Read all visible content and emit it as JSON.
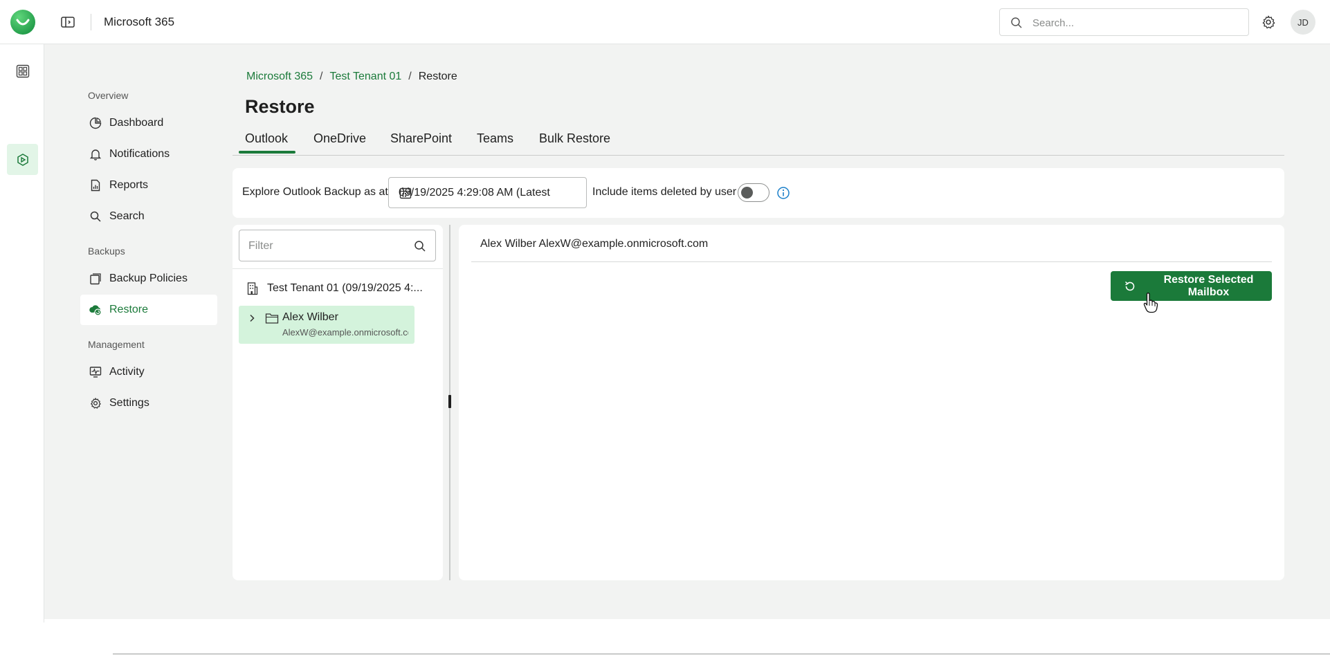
{
  "header": {
    "app_title": "Microsoft 365",
    "search_placeholder": "Search...",
    "avatar_initials": "JD"
  },
  "nav": {
    "sections": [
      {
        "label": "Overview",
        "items": [
          "Dashboard",
          "Notifications",
          "Reports",
          "Search"
        ]
      },
      {
        "label": "Backups",
        "items": [
          "Backup Policies",
          "Restore"
        ]
      },
      {
        "label": "Management",
        "items": [
          "Activity",
          "Settings"
        ]
      }
    ],
    "active_item": "Restore"
  },
  "breadcrumb": {
    "items": [
      "Microsoft 365",
      "Test Tenant 01",
      "Restore"
    ],
    "separator": "/"
  },
  "page": {
    "title": "Restore",
    "tabs": [
      "Outlook",
      "OneDrive",
      "SharePoint",
      "Teams",
      "Bulk Restore"
    ],
    "active_tab": "Outlook"
  },
  "explore": {
    "label": "Explore Outlook Backup as at",
    "date_value": "09/19/2025 4:29:08 AM  (Latest",
    "include_deleted_label": "Include items deleted by user",
    "include_deleted_on": false
  },
  "tree": {
    "filter_placeholder": "Filter",
    "tenant_label": "Test Tenant 01 (09/19/2025 4:...",
    "user_name": "Alex Wilber",
    "user_email": "AlexW@example.onmicrosoft.com"
  },
  "content": {
    "mailbox_header": "Alex Wilber AlexW@example.onmicrosoft.com",
    "restore_button_label": "Restore Selected Mailbox"
  },
  "colors": {
    "accent": "#1b7a3a",
    "selection": "#d4f3dc",
    "background": "#f2f3f2"
  }
}
